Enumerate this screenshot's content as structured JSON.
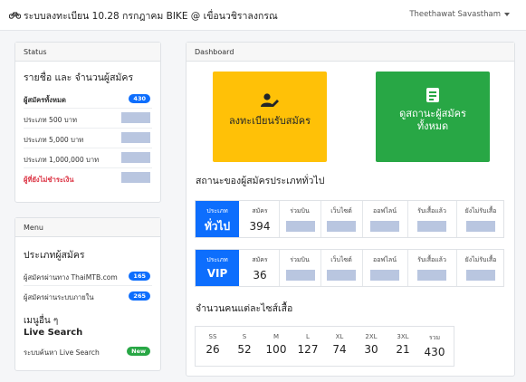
{
  "navbar": {
    "brand_icon": "bicycle-icon",
    "brand": "ระบบลงทะเบียน 10.28 กรกฎาคม BIKE @ เขื่อนวชิราลงกรณ",
    "user": "Theethawat Savastham"
  },
  "status": {
    "header": "Status",
    "title": "รายชื่อ และ จำนวนผู้สมัคร",
    "items": [
      {
        "label": "ผู้สมัครทั้งหมด",
        "badge": "430"
      },
      {
        "label": "ประเภท 500 บาท"
      },
      {
        "label": "ประเภท 5,000 บาท"
      },
      {
        "label": "ประเภท 1,000,000 บาท"
      },
      {
        "label": "ผู้ที่ยังไม่ชำระเงิน"
      }
    ]
  },
  "menu": {
    "header": "Menu",
    "title": "ประเภทผู้สมัคร",
    "items": [
      {
        "label": "ผู้สมัครผ่านทาง ThaiMTB.com",
        "badge": "165"
      },
      {
        "label": "ผู้สมัครผ่านระบบภายใน",
        "badge": "265"
      }
    ],
    "other_title": "เมนูอื่น ๆ",
    "live_title": "Live Search",
    "live_item": {
      "label": "ระบบค้นหา Live Search",
      "badge": "New"
    }
  },
  "dashboard": {
    "header": "Dashboard",
    "register_button": "ลงทะเบียนรับสมัคร",
    "register_icon": "user-edit-icon",
    "all_button_line1": "ดูสถานะผู้สมัคร",
    "all_button_line2": "ทั้งหมด",
    "all_icon": "document-icon",
    "status_heading": "สถานะของผู้สมัครประเภททั่วไป",
    "general": {
      "type_label": "ประเภท",
      "type_name": "ทั่วไป",
      "cols": [
        "สมัคร",
        "ร่วมบิน",
        "เว็บไซต์",
        "ออฟไลน์",
        "รับเสื้อแล้ว",
        "ยังไม่รับเสื้อ"
      ],
      "applied": "394"
    },
    "vip": {
      "type_label": "ประเภท",
      "type_name": "VIP",
      "cols": [
        "สมัคร",
        "ร่วมบิน",
        "เว็บไซต์",
        "ออฟไลน์",
        "รับเสื้อแล้ว",
        "ยังไม่รับเสื้อ"
      ],
      "applied": "36"
    },
    "size_heading": "จำนวนคนแต่ละไซส์เสื้อ",
    "sizes": [
      {
        "label": "SS",
        "value": "26"
      },
      {
        "label": "S",
        "value": "52"
      },
      {
        "label": "M",
        "value": "100"
      },
      {
        "label": "L",
        "value": "127"
      },
      {
        "label": "XL",
        "value": "74"
      },
      {
        "label": "2XL",
        "value": "30"
      },
      {
        "label": "3XL",
        "value": "21"
      },
      {
        "label": "รวม",
        "value": "430"
      }
    ]
  },
  "colors": {
    "primary": "#0d6efd",
    "warning": "#ffc107",
    "success": "#28a745",
    "danger": "#dc3545",
    "redaction": "#b9c6e0"
  }
}
